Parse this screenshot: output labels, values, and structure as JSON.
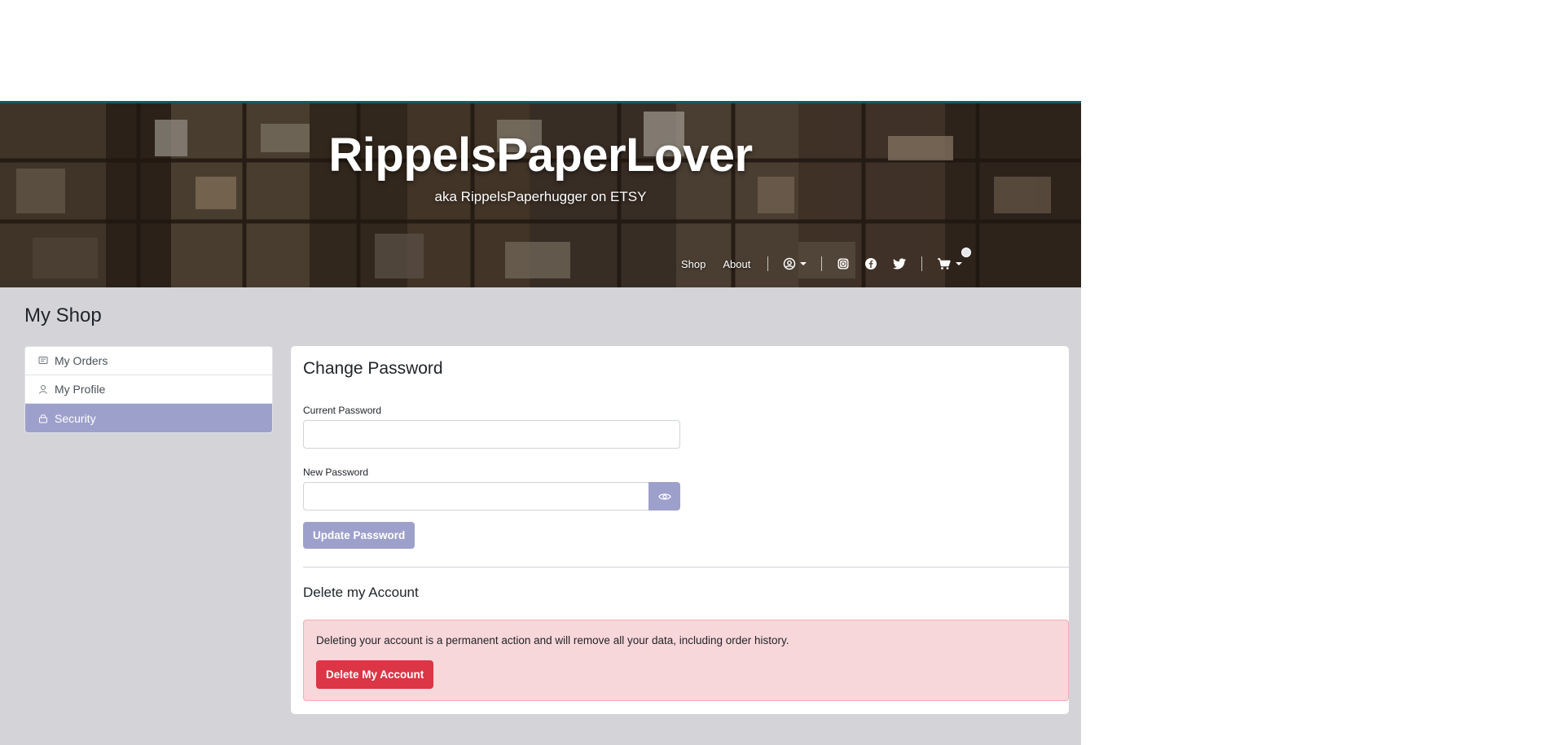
{
  "header": {
    "title": "RippelsPaperLover",
    "subtitle": "aka RippelsPaperhugger on ETSY"
  },
  "nav": {
    "links": [
      "Shop",
      "About"
    ],
    "icons": [
      "user-circle-icon",
      "instagram-icon",
      "facebook-icon",
      "twitter-icon",
      "cart-icon"
    ]
  },
  "page": {
    "title": "My Shop"
  },
  "sidebar": {
    "items": [
      {
        "label": "My Orders",
        "icon": "orders-icon"
      },
      {
        "label": "My Profile",
        "icon": "user-icon"
      },
      {
        "label": "Security",
        "icon": "lock-icon"
      }
    ],
    "active": "Security"
  },
  "change_password": {
    "title": "Change Password",
    "current_label": "Current Password",
    "current_value": "",
    "new_label": "New Password",
    "new_value": "",
    "submit_label": "Update Password"
  },
  "delete_account": {
    "title": "Delete my Account",
    "warning": "Deleting your account is a permanent action and will remove all your data, including order history.",
    "button_label": "Delete My Account"
  },
  "colors": {
    "accent": "#9ea0cc",
    "danger": "#dc3545",
    "alert_bg": "#f8d7da",
    "page_bg": "#d4d4d8",
    "header_border": "#17595f"
  }
}
